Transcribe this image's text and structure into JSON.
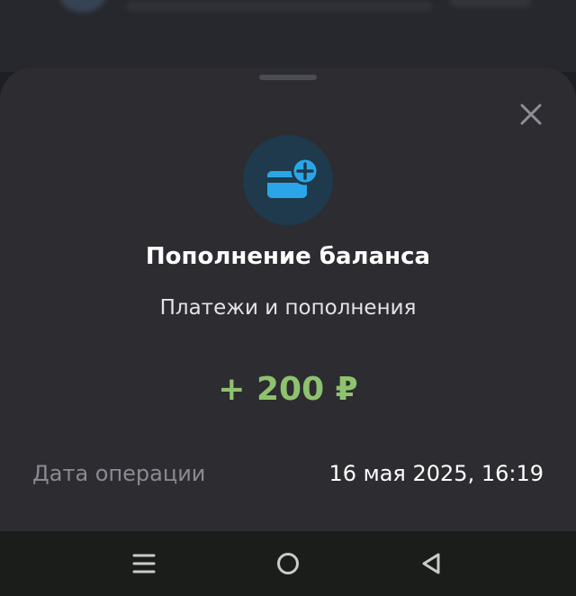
{
  "transaction": {
    "title": "Пополнение баланса",
    "category": "Платежи и пополнения",
    "amount": "+ 200 ₽",
    "details": [
      {
        "label": "Дата операции",
        "value": "16 мая 2025, 16:19"
      }
    ]
  },
  "icons": {
    "close": "close-icon",
    "category": "card-plus-icon",
    "nav_menu": "menu-icon",
    "nav_home": "home-circle-icon",
    "nav_back": "back-triangle-icon"
  },
  "colors": {
    "sheet_background": "#2c2c31",
    "icon_circle": "#1e3a4c",
    "icon_accent": "#2aa6e8",
    "amount_positive": "#8fc26e",
    "label_muted": "#8a8b92",
    "navbar_background": "#1a1d1a"
  }
}
